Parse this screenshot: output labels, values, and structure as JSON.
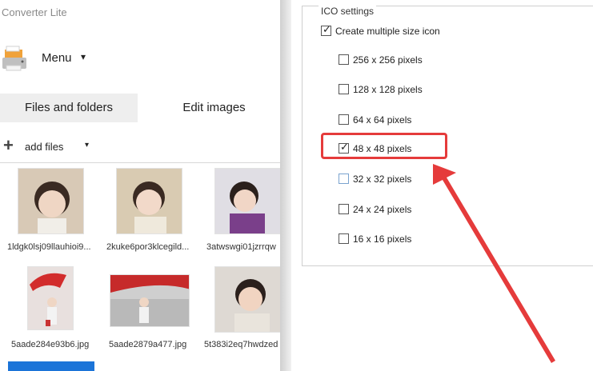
{
  "app": {
    "title": "Converter Lite"
  },
  "menu": {
    "label": "Menu",
    "caret": "▾"
  },
  "tabs": [
    {
      "label": "Files and folders",
      "active": true
    },
    {
      "label": "Edit images",
      "active": false
    }
  ],
  "toolbar": {
    "add_files_label": "add files",
    "plus": "+",
    "caret": "▾"
  },
  "files": [
    {
      "name": "1ldgk0lsj09llauhioi9...",
      "bg": "#d8c9b6"
    },
    {
      "name": "2kuke6por3klcegild...",
      "bg": "#d9cbb2"
    },
    {
      "name": "3atwswgi01jzrrqw",
      "bg": "#e0dee4"
    },
    {
      "name": "5aade284e93b6.jpg",
      "bg": "#e8e0de"
    },
    {
      "name": "5aade2879a477.jpg",
      "bg": "#cfcfcf"
    },
    {
      "name": "5t383i2eq7hwdzed",
      "bg": "#ded9d3"
    }
  ],
  "ico_settings": {
    "title": "ICO settings",
    "options": [
      {
        "label": "Create multiple size icon",
        "checked": true
      },
      {
        "label": "256 x 256 pixels",
        "checked": false
      },
      {
        "label": "128 x 128 pixels",
        "checked": false
      },
      {
        "label": "64 x 64 pixels",
        "checked": false
      },
      {
        "label": "48 x 48 pixels",
        "checked": true
      },
      {
        "label": "32 x 32 pixels",
        "checked": false
      },
      {
        "label": "24 x 24 pixels",
        "checked": false
      },
      {
        "label": "16 x 16 pixels",
        "checked": false
      }
    ]
  },
  "colors": {
    "annotation": "#e53b3b",
    "selection": "#1b74d8",
    "tab_active_bg": "#eeeeee"
  },
  "icons": {
    "printer": "printer-icon",
    "plus": "plus-icon",
    "checkmark": "✓"
  }
}
